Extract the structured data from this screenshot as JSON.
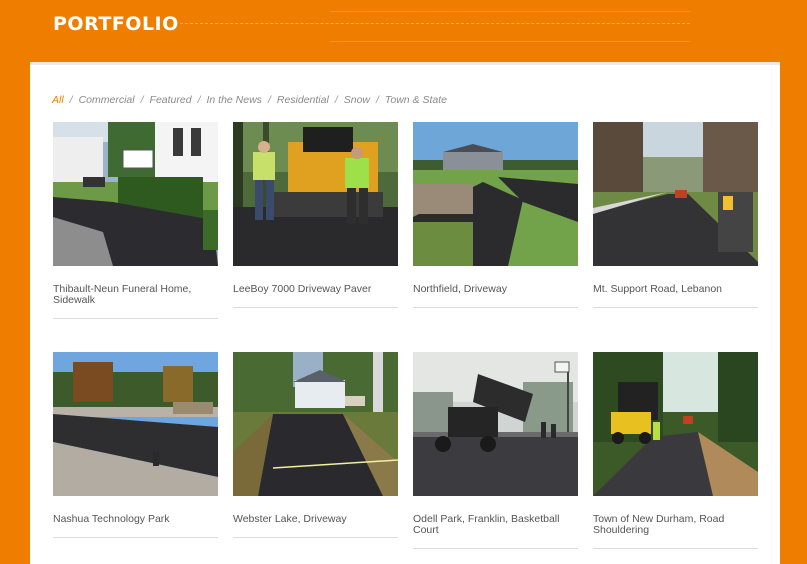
{
  "header": {
    "title": "PORTFOLIO"
  },
  "filters": [
    {
      "label": "All",
      "active": true
    },
    {
      "label": "Commercial",
      "active": false
    },
    {
      "label": "Featured",
      "active": false
    },
    {
      "label": "In the News",
      "active": false
    },
    {
      "label": "Residential",
      "active": false
    },
    {
      "label": "Snow",
      "active": false
    },
    {
      "label": "Town & State",
      "active": false
    }
  ],
  "filter_separator": "/",
  "projects": [
    {
      "caption": "Thibault-Neun Funeral Home, Sidewalk"
    },
    {
      "caption": "LeeBoy 7000 Driveway Paver"
    },
    {
      "caption": "Northfield, Driveway"
    },
    {
      "caption": "Mt. Support Road, Lebanon"
    },
    {
      "caption": "Nashua Technology Park"
    },
    {
      "caption": "Webster Lake, Driveway"
    },
    {
      "caption": "Odell Park, Franklin, Basketball Court"
    },
    {
      "caption": "Town of New Durham, Road Shouldering"
    }
  ]
}
